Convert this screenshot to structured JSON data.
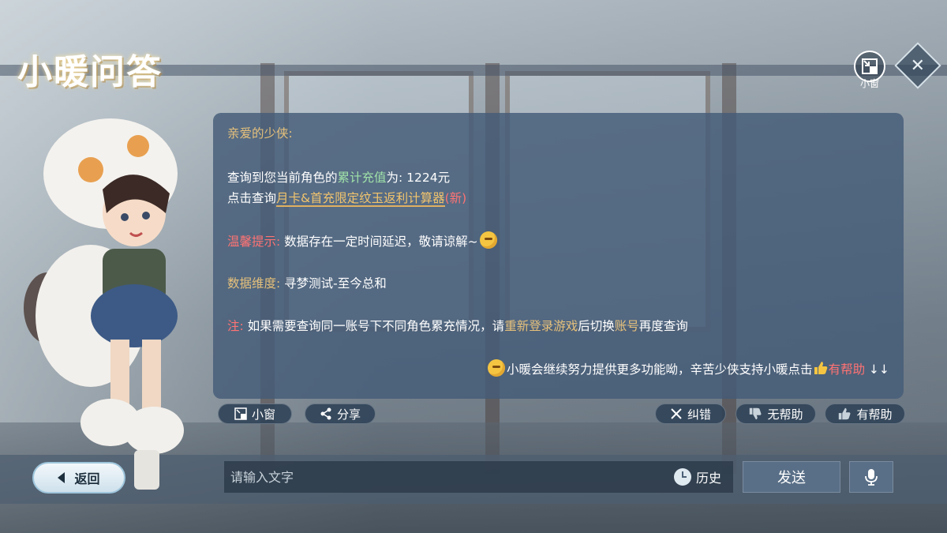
{
  "header": {
    "title": "小暖问答",
    "mini_window_label": "小窗"
  },
  "message": {
    "greeting": "亲爱的少侠:",
    "query_prefix": "查询到您当前角色的",
    "query_highlight": "累计充值",
    "query_suffix": "为: 1224元",
    "click_prefix": "点击查询",
    "calculator_link": "月卡&首充限定纹玉返利计算器",
    "new_tag": "(新)",
    "tip_label": "温馨提示:",
    "tip_text": "数据存在一定时间延迟，敬请谅解~",
    "dimension_label": "数据维度:",
    "dimension_text": "寻梦测试-至今总和",
    "note_label": "注:",
    "note_text_1": "如果需要查询同一账号下不同角色累充情况，请",
    "note_highlight_1": "重新登录游戏",
    "note_text_2": "后切换",
    "note_highlight_2": "账号",
    "note_text_3": "再度查询",
    "footer_text": "小暖会继续努力提供更多功能呦，辛苦少侠支持小暖点击",
    "footer_highlight": "有帮助",
    "footer_arrows": "↓↓"
  },
  "actions": {
    "mini_window": "小窗",
    "share": "分享",
    "correct": "纠错",
    "not_helpful": "无帮助",
    "helpful": "有帮助"
  },
  "bottom": {
    "back": "返回",
    "input_placeholder": "请输入文字",
    "history": "历史",
    "send": "发送"
  },
  "colors": {
    "gold": "#e5c07b",
    "green": "#9fe0a8",
    "red": "#ff7373",
    "panel": "#445c78"
  }
}
